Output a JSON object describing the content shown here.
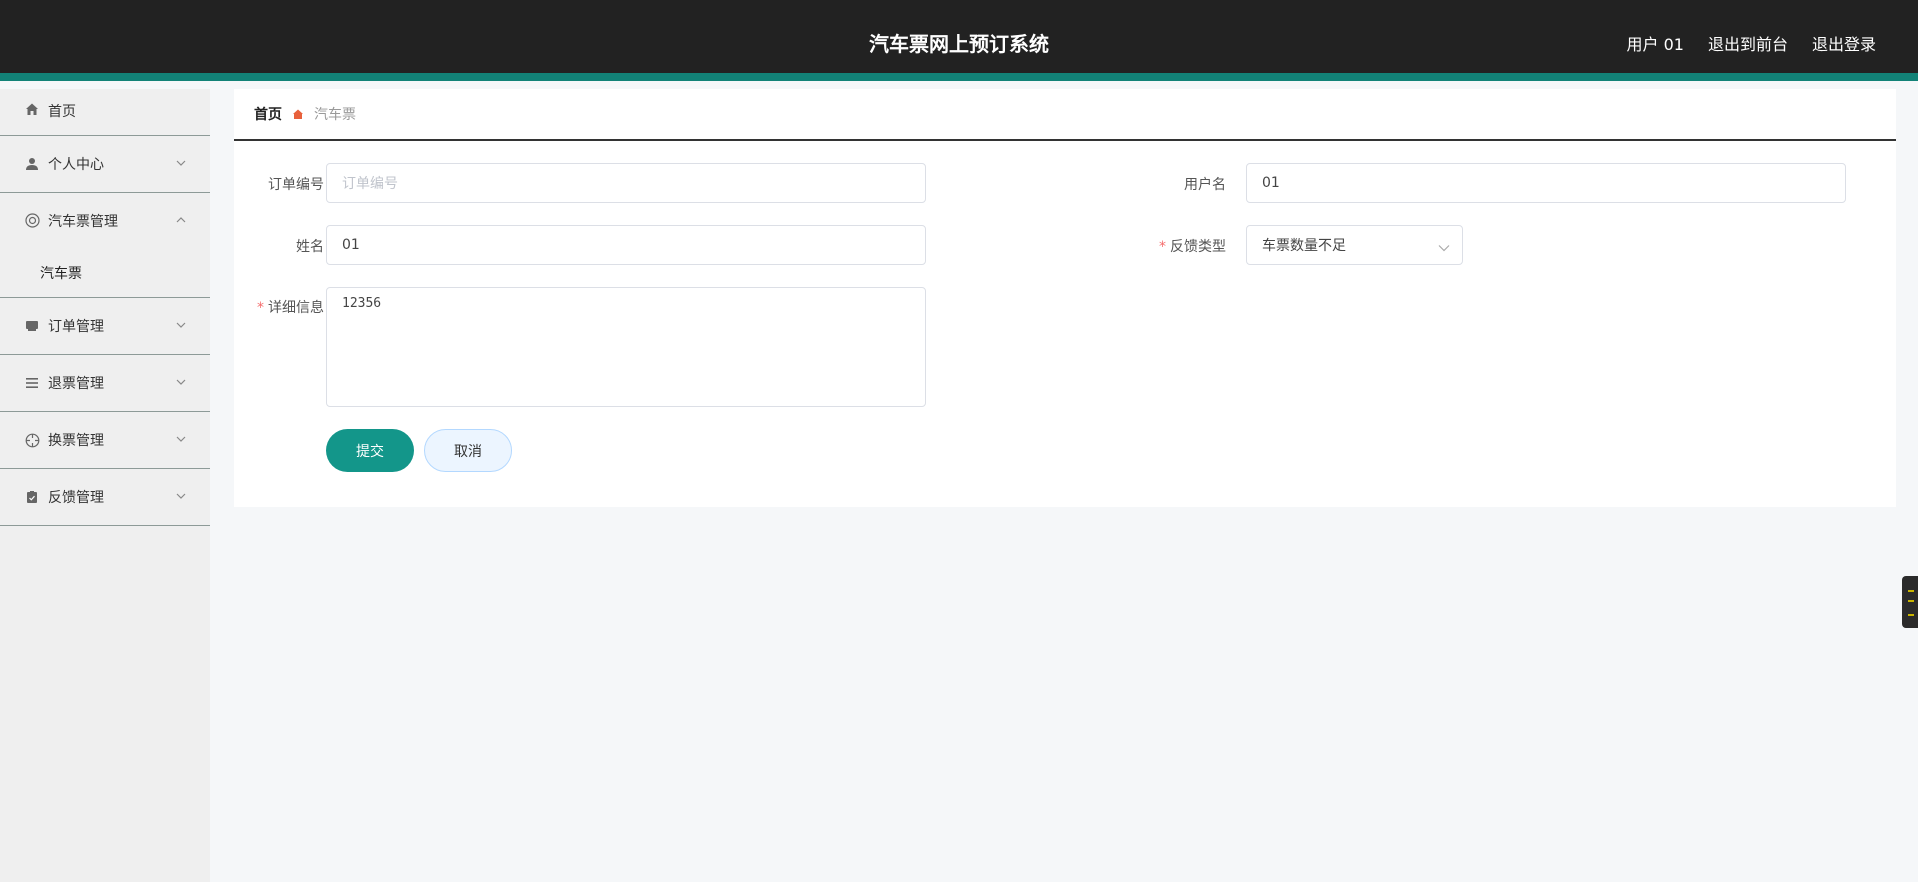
{
  "header": {
    "title": "汽车票网上预订系统",
    "user": "用户 01",
    "to_front": "退出到前台",
    "logout": "退出登录"
  },
  "sidebar": {
    "items": [
      {
        "label": "首页",
        "icon": "home-icon"
      },
      {
        "label": "个人中心",
        "icon": "user-icon"
      },
      {
        "label": "汽车票管理",
        "icon": "lifebuoy-icon",
        "expanded": true
      },
      {
        "label": "汽车票",
        "sub": true
      },
      {
        "label": "订单管理",
        "icon": "inbox-icon"
      },
      {
        "label": "退票管理",
        "icon": "list-icon"
      },
      {
        "label": "换票管理",
        "icon": "crosshair-icon"
      },
      {
        "label": "反馈管理",
        "icon": "clipboard-icon"
      }
    ]
  },
  "breadcrumb": {
    "home": "首页",
    "current": "汽车票"
  },
  "form": {
    "order_no_label": "订单编号",
    "order_no_placeholder": "订单编号",
    "username_label": "用户名",
    "username_value": "01",
    "name_label": "姓名",
    "name_value": "01",
    "feedback_type_label": "反馈类型",
    "feedback_type_value": "车票数量不足",
    "detail_label": "详细信息",
    "detail_value": "12356",
    "submit_label": "提交",
    "cancel_label": "取消"
  },
  "colors": {
    "header_bg": "#222222",
    "accent": "#128277",
    "button_primary": "#13968a",
    "required": "#f56c6c"
  }
}
